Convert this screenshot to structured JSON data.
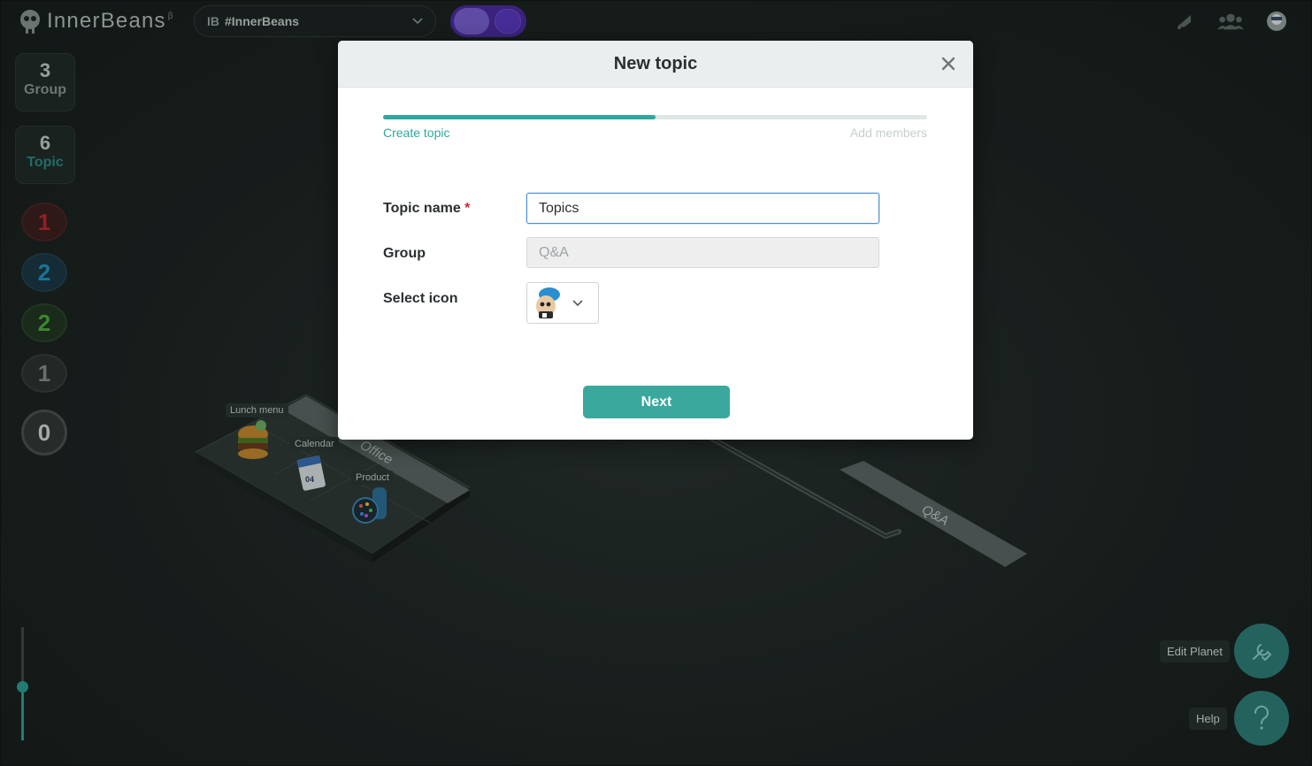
{
  "app": {
    "logo_text": "InnerBeans",
    "logo_sup": "β"
  },
  "org_select": {
    "prefix": "IB",
    "name": "#InnerBeans"
  },
  "sidebar": {
    "group": {
      "count": "3",
      "label": "Group"
    },
    "topic": {
      "count": "6",
      "label": "Topic"
    },
    "badges": [
      {
        "value": "1",
        "color": "#c0262a"
      },
      {
        "value": "2",
        "color": "#2096c5"
      },
      {
        "value": "2",
        "color": "#4cae3c"
      },
      {
        "value": "1",
        "color": "#8a8f8f"
      },
      {
        "value": "0",
        "color": "#d8dcdc"
      }
    ]
  },
  "zoom": {
    "level": 0.48
  },
  "scene": {
    "tiles": [
      {
        "label": "Lunch menu"
      },
      {
        "label": "Calendar"
      },
      {
        "label": "Product"
      }
    ],
    "zones": [
      "Office",
      "Q&A"
    ]
  },
  "actions": {
    "edit_planet": "Edit Planet",
    "help": "Help"
  },
  "modal": {
    "title": "New topic",
    "progress": 0.5,
    "steps": [
      "Create topic",
      "Add members"
    ],
    "fields": {
      "topic_name": {
        "label": "Topic name",
        "required_mark": "*",
        "value": "Topics"
      },
      "group": {
        "label": "Group",
        "value": "Q&A"
      },
      "icon": {
        "label": "Select icon",
        "selected": "chef-bean-icon"
      }
    },
    "next_label": "Next"
  }
}
